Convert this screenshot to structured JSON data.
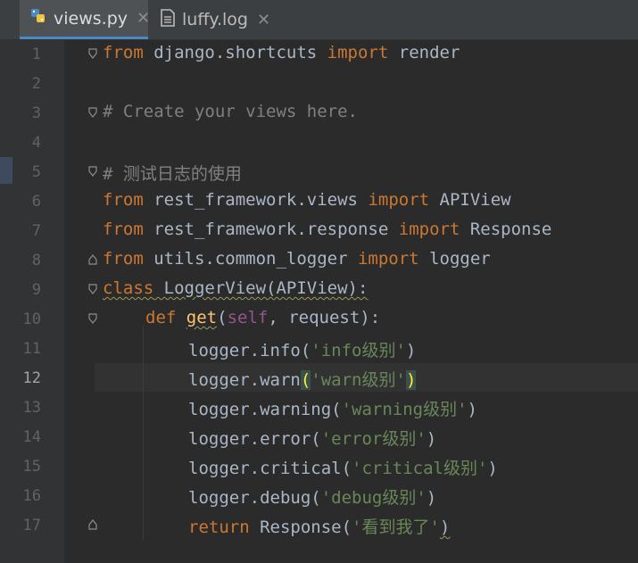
{
  "tabs": [
    {
      "label": "views.py",
      "icon": "python-file-icon",
      "active": true
    },
    {
      "label": "luffy.log",
      "icon": "log-file-icon",
      "active": false
    }
  ],
  "close_glyph": "✕",
  "current_line": 12,
  "line_numbers": [
    "1",
    "2",
    "3",
    "4",
    "5",
    "6",
    "7",
    "8",
    "9",
    "10",
    "11",
    "12",
    "13",
    "14",
    "15",
    "16",
    "17"
  ],
  "colors": {
    "keyword": "#cc7832",
    "comment": "#808080",
    "string": "#6a8759",
    "function": "#ffc66d",
    "self": "#94558d",
    "text": "#a9b7c6",
    "background": "#2b2b2b"
  },
  "code": {
    "l1": {
      "kw1": "from",
      "t1": " django.shortcuts ",
      "kw2": "import",
      "t2": " render"
    },
    "l3": {
      "comment": "# Create your views here."
    },
    "l5": {
      "comment": "# 测试日志的使用"
    },
    "l6": {
      "kw1": "from",
      "t1": " rest_framework.views ",
      "kw2": "import",
      "t2": " APIView"
    },
    "l7": {
      "kw1": "from",
      "t1": " rest_framework.response ",
      "kw2": "import",
      "t2": " Response"
    },
    "l8": {
      "kw1": "from",
      "t1": " utils.common_logger ",
      "kw2": "import",
      "t2": " logger"
    },
    "l9": {
      "kw": "class",
      "t1": " LoggerView(APIView):"
    },
    "l10": {
      "kw": "def",
      "sp": " ",
      "fn": "get",
      "p1": "(",
      "self": "self",
      "p2": ", request):"
    },
    "l11": {
      "t1": "logger.info(",
      "str": "'info级别'",
      "t2": ")"
    },
    "l12": {
      "t1": "logger.warn",
      "open": "(",
      "str": "'warn级别'",
      "close": ")"
    },
    "l13": {
      "t1": "logger.warning(",
      "str": "'warning级别'",
      "t2": ")"
    },
    "l14": {
      "t1": "logger.error(",
      "str": "'error级别'",
      "t2": ")"
    },
    "l15": {
      "t1": "logger.critical(",
      "str": "'critical级别'",
      "t2": ")"
    },
    "l16": {
      "t1": "logger.debug(",
      "str": "'debug级别'",
      "t2": ")"
    },
    "l17": {
      "kw": "return",
      "t1": " Response(",
      "str": "'看到我了'",
      "t2": ")"
    }
  }
}
